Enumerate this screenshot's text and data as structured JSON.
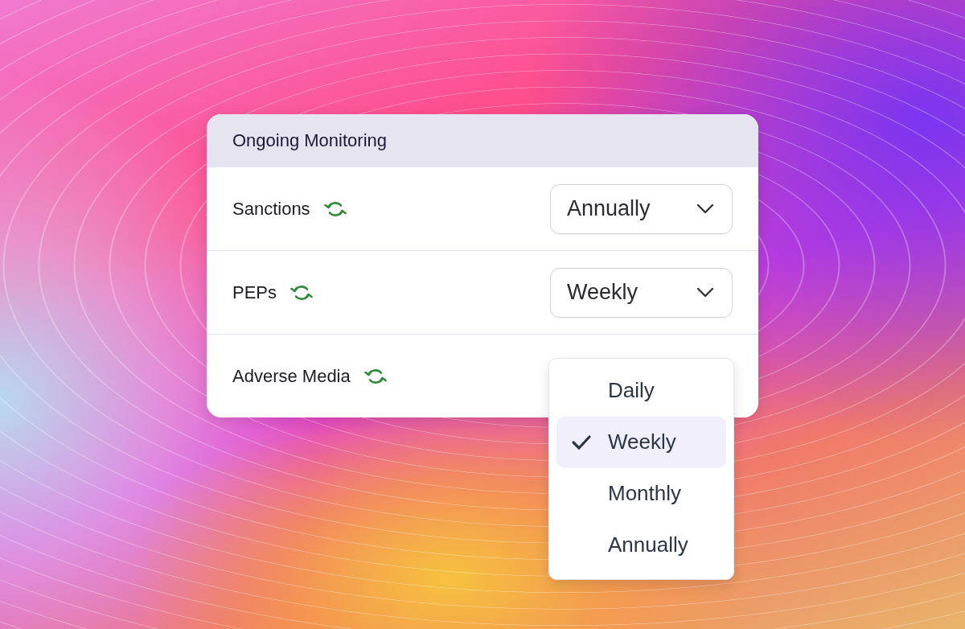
{
  "card": {
    "title": "Ongoing Monitoring",
    "rows": [
      {
        "label": "Sanctions",
        "select": {
          "value": "Annually"
        }
      },
      {
        "label": "PEPs",
        "select": {
          "value": "Weekly",
          "menu": [
            {
              "label": "Daily",
              "selected": false
            },
            {
              "label": "Weekly",
              "selected": true
            },
            {
              "label": "Monthly",
              "selected": false
            },
            {
              "label": "Annually",
              "selected": false
            }
          ]
        }
      },
      {
        "label": "Adverse Media"
      }
    ]
  }
}
